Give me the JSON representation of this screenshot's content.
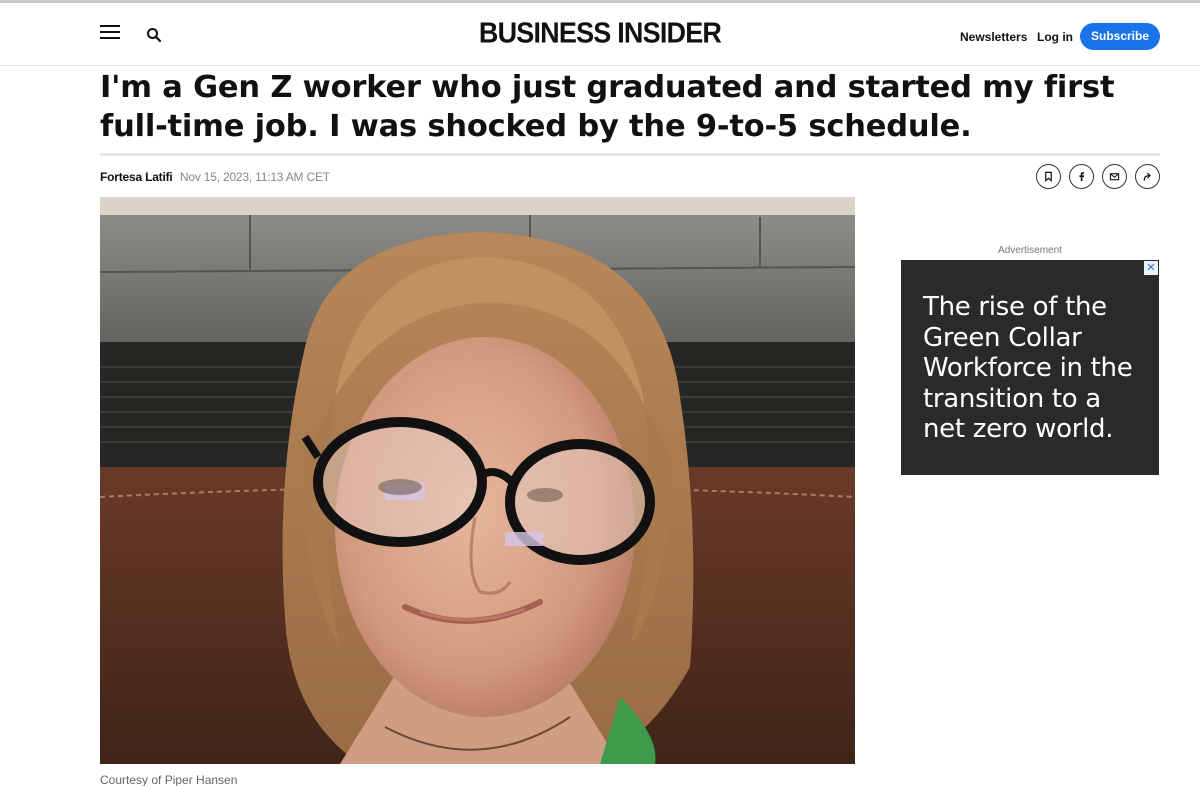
{
  "header": {
    "logo": "BUSINESS INSIDER",
    "menu_icon": "hamburger-menu-icon",
    "search_icon": "search-icon",
    "newsletters": "Newsletters",
    "login": "Log in",
    "subscribe": "Subscribe",
    "accent_color": "#1a73e8"
  },
  "article": {
    "headline": "I'm a Gen Z worker who just graduated and started my first full-time job. I was shocked by the 9-to-5 schedule.",
    "author": "Fortesa Latifi",
    "date": "Nov 15, 2023, 11:13 AM CET",
    "share_icons": [
      "bookmark-icon",
      "facebook-icon",
      "email-icon",
      "share-icon"
    ],
    "image_caption": "Courtesy of Piper Hansen"
  },
  "sidebar": {
    "ad_label": "Advertisement",
    "ad_text": "The rise of the Green Collar Workforce in the transition to a net zero world.",
    "ad_close": "✕",
    "ad_background": "#2a2a2a"
  }
}
